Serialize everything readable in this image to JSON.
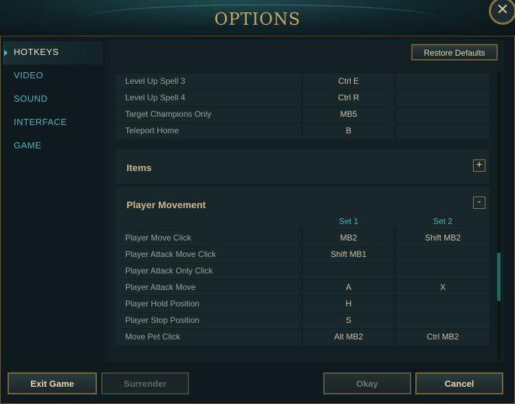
{
  "window": {
    "title": "OPTIONS",
    "close_glyph": "✕"
  },
  "sidebar": {
    "items": [
      {
        "label": "HOTKEYS",
        "active": true
      },
      {
        "label": "VIDEO",
        "active": false
      },
      {
        "label": "SOUND",
        "active": false
      },
      {
        "label": "INTERFACE",
        "active": false
      },
      {
        "label": "GAME",
        "active": false
      }
    ]
  },
  "toolbar": {
    "restore_label": "Restore Defaults"
  },
  "hotkeys_top": [
    {
      "action": "Level Up Spell 3",
      "set1": "Ctrl  E",
      "set2": ""
    },
    {
      "action": "Level Up Spell 4",
      "set1": "Ctrl  R",
      "set2": ""
    },
    {
      "action": "Target Champions Only",
      "set1": "MB5",
      "set2": ""
    },
    {
      "action": "Teleport Home",
      "set1": "B",
      "set2": ""
    }
  ],
  "sections": {
    "items": {
      "title": "Items",
      "toggle": "+"
    },
    "player_movement": {
      "title": "Player Movement",
      "toggle": "-"
    }
  },
  "columns": {
    "set1": "Set 1",
    "set2": "Set 2"
  },
  "player_movement_rows": [
    {
      "action": "Player Move Click",
      "set1": "MB2",
      "set2": "Shift  MB2"
    },
    {
      "action": "Player Attack Move Click",
      "set1": "Shift  MB1",
      "set2": ""
    },
    {
      "action": "Player Attack Only Click",
      "set1": "",
      "set2": ""
    },
    {
      "action": "Player Attack Move",
      "set1": "A",
      "set2": "X"
    },
    {
      "action": "Player Hold Position",
      "set1": "H",
      "set2": ""
    },
    {
      "action": "Player Stop Position",
      "set1": "S",
      "set2": ""
    },
    {
      "action": "Move Pet Click",
      "set1": "Alt  MB2",
      "set2": "Ctrl  MB2"
    }
  ],
  "footer": {
    "exit_label": "Exit Game",
    "surrender_label": "Surrender",
    "okay_label": "Okay",
    "cancel_label": "Cancel"
  }
}
